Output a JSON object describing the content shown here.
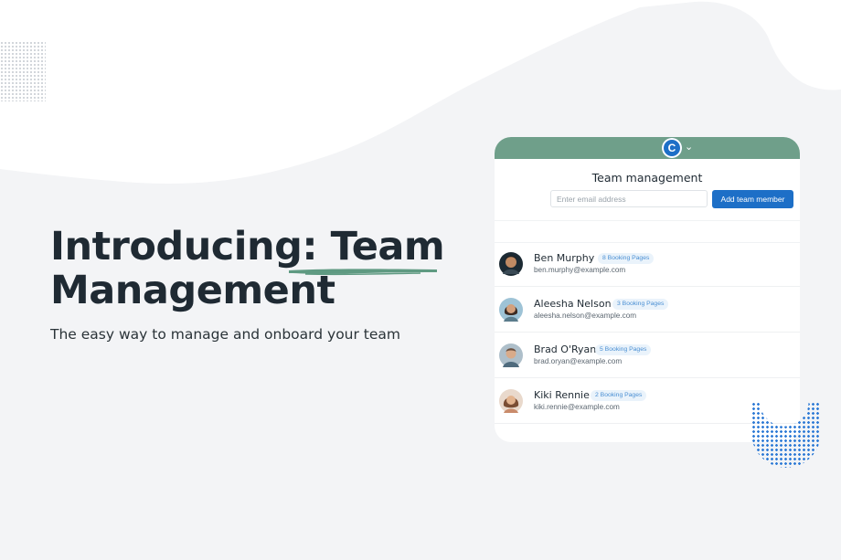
{
  "hero": {
    "headline_line1": "Introducing: Team",
    "headline_line2": "Management",
    "subtitle": "The easy way to manage and onboard your team"
  },
  "colors": {
    "background": "#f3f4f6",
    "accent_green": "#6f9f8a",
    "primary_blue": "#1d6fc7",
    "badge_bg": "#eaf3fb",
    "badge_text": "#4a8fd3"
  },
  "card": {
    "logo_icon": "calendly-logo-icon",
    "logo_glyph": "C",
    "chevron_glyph": "⌄",
    "title": "Team management",
    "email_placeholder": "Enter email address",
    "add_button_label": "Add team member",
    "members": [
      {
        "name": "Ben Murphy",
        "badge": "8 Booking Pages",
        "email": "ben.murphy@example.com"
      },
      {
        "name": "Aleesha Nelson",
        "badge": "3 Booking Pages",
        "email": "aleesha.nelson@example.com"
      },
      {
        "name": "Brad O'Ryan",
        "badge": "5 Booking Pages",
        "email": "brad.oryan@example.com"
      },
      {
        "name": "Kiki Rennie",
        "badge": "2 Booking Pages",
        "email": "kiki.rennie@example.com"
      }
    ]
  }
}
